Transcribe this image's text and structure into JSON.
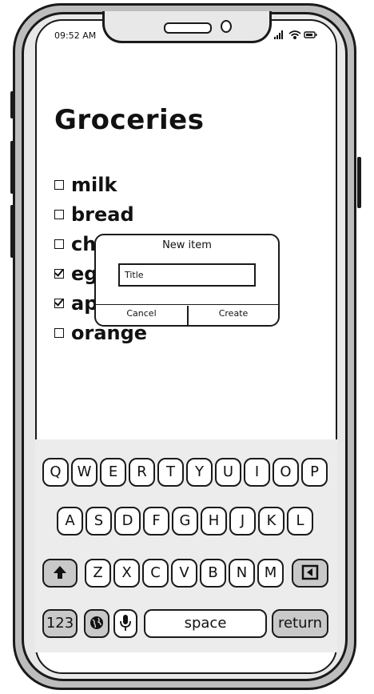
{
  "status_bar": {
    "time": "09:52 AM",
    "icons": [
      "signal-icon",
      "wifi-icon",
      "battery-icon"
    ]
  },
  "page": {
    "title": "Groceries"
  },
  "list": {
    "items": [
      {
        "label": "milk",
        "checked": false
      },
      {
        "label": "bread",
        "checked": false
      },
      {
        "label": "ch",
        "checked": false
      },
      {
        "label": "eg",
        "checked": true
      },
      {
        "label": "ap",
        "checked": true
      },
      {
        "label": "orange",
        "checked": false
      }
    ]
  },
  "dialog": {
    "title": "New item",
    "input_placeholder": "Title",
    "input_value": "",
    "cancel_label": "Cancel",
    "create_label": "Create"
  },
  "keyboard": {
    "row1": [
      "Q",
      "W",
      "E",
      "R",
      "T",
      "Y",
      "U",
      "I",
      "O",
      "P"
    ],
    "row2": [
      "A",
      "S",
      "D",
      "F",
      "G",
      "H",
      "J",
      "K",
      "L"
    ],
    "row3": [
      "Z",
      "X",
      "C",
      "V",
      "B",
      "N",
      "M"
    ],
    "numbers_label": "123",
    "space_label": "space",
    "return_label": "return"
  },
  "colors": {
    "ink": "#1a1a1a",
    "keyboard_bg": "#ececec",
    "modifier_key": "#c9c9c9"
  }
}
